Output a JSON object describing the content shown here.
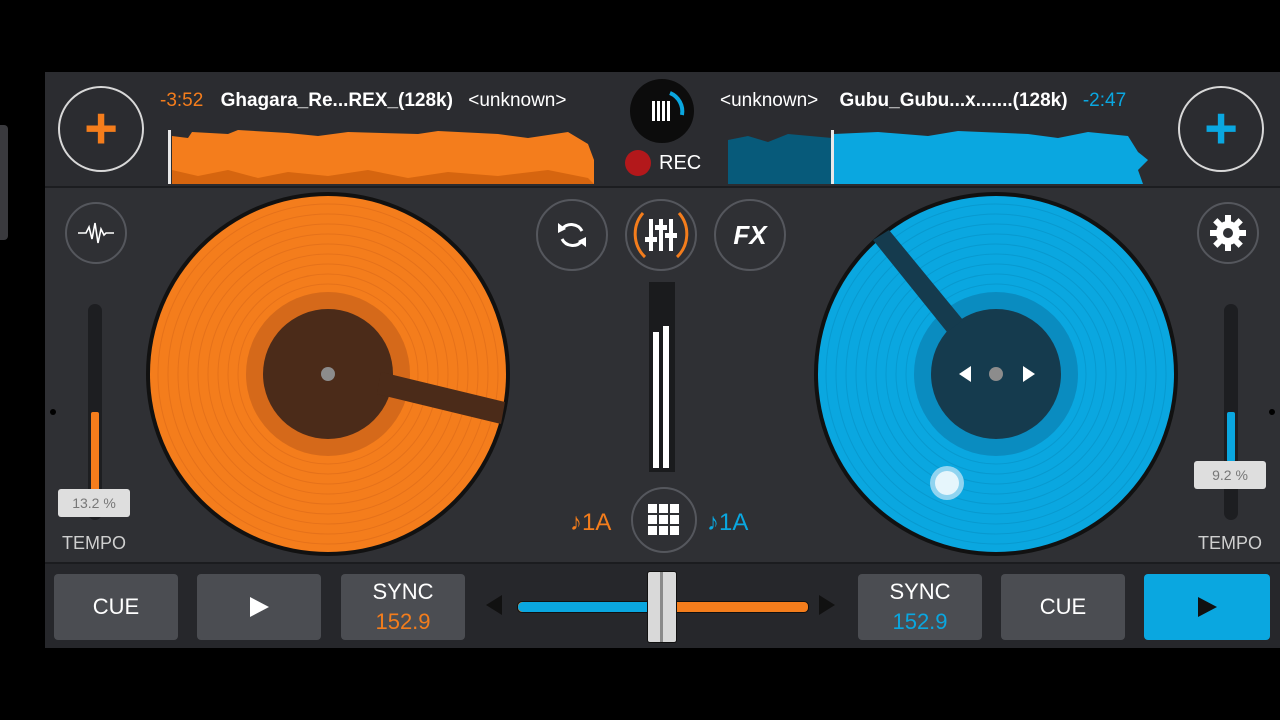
{
  "deck_a": {
    "time_remaining": "-3:52",
    "title": "Ghagara_Re...REX_(128k)",
    "artist": "<unknown>",
    "tempo_pct": "13.2 %",
    "tempo_label": "TEMPO",
    "key": "♪1A",
    "cue_label": "CUE",
    "sync_label": "SYNC",
    "bpm": "152.9",
    "color": "#f47d1c"
  },
  "deck_b": {
    "time_remaining": "-2:47",
    "title": "Gubu_Gubu...x.......(128k)",
    "artist": "<unknown>",
    "tempo_pct": "9.2 %",
    "tempo_label": "TEMPO",
    "key": "♪1A",
    "cue_label": "CUE",
    "sync_label": "SYNC",
    "bpm": "152.9",
    "color": "#0aa7e0"
  },
  "center": {
    "rec_label": "REC",
    "fx_label": "FX"
  },
  "icons": [
    "add-track-icon",
    "rec-dot-icon",
    "waveform-icon",
    "sync-loop-icon",
    "mixer-icon",
    "fx-icon",
    "settings-icon",
    "grid-icon",
    "play-icon",
    "crossfader-left-icon",
    "crossfader-right-icon"
  ],
  "crossfader": {
    "position": 0.5
  }
}
